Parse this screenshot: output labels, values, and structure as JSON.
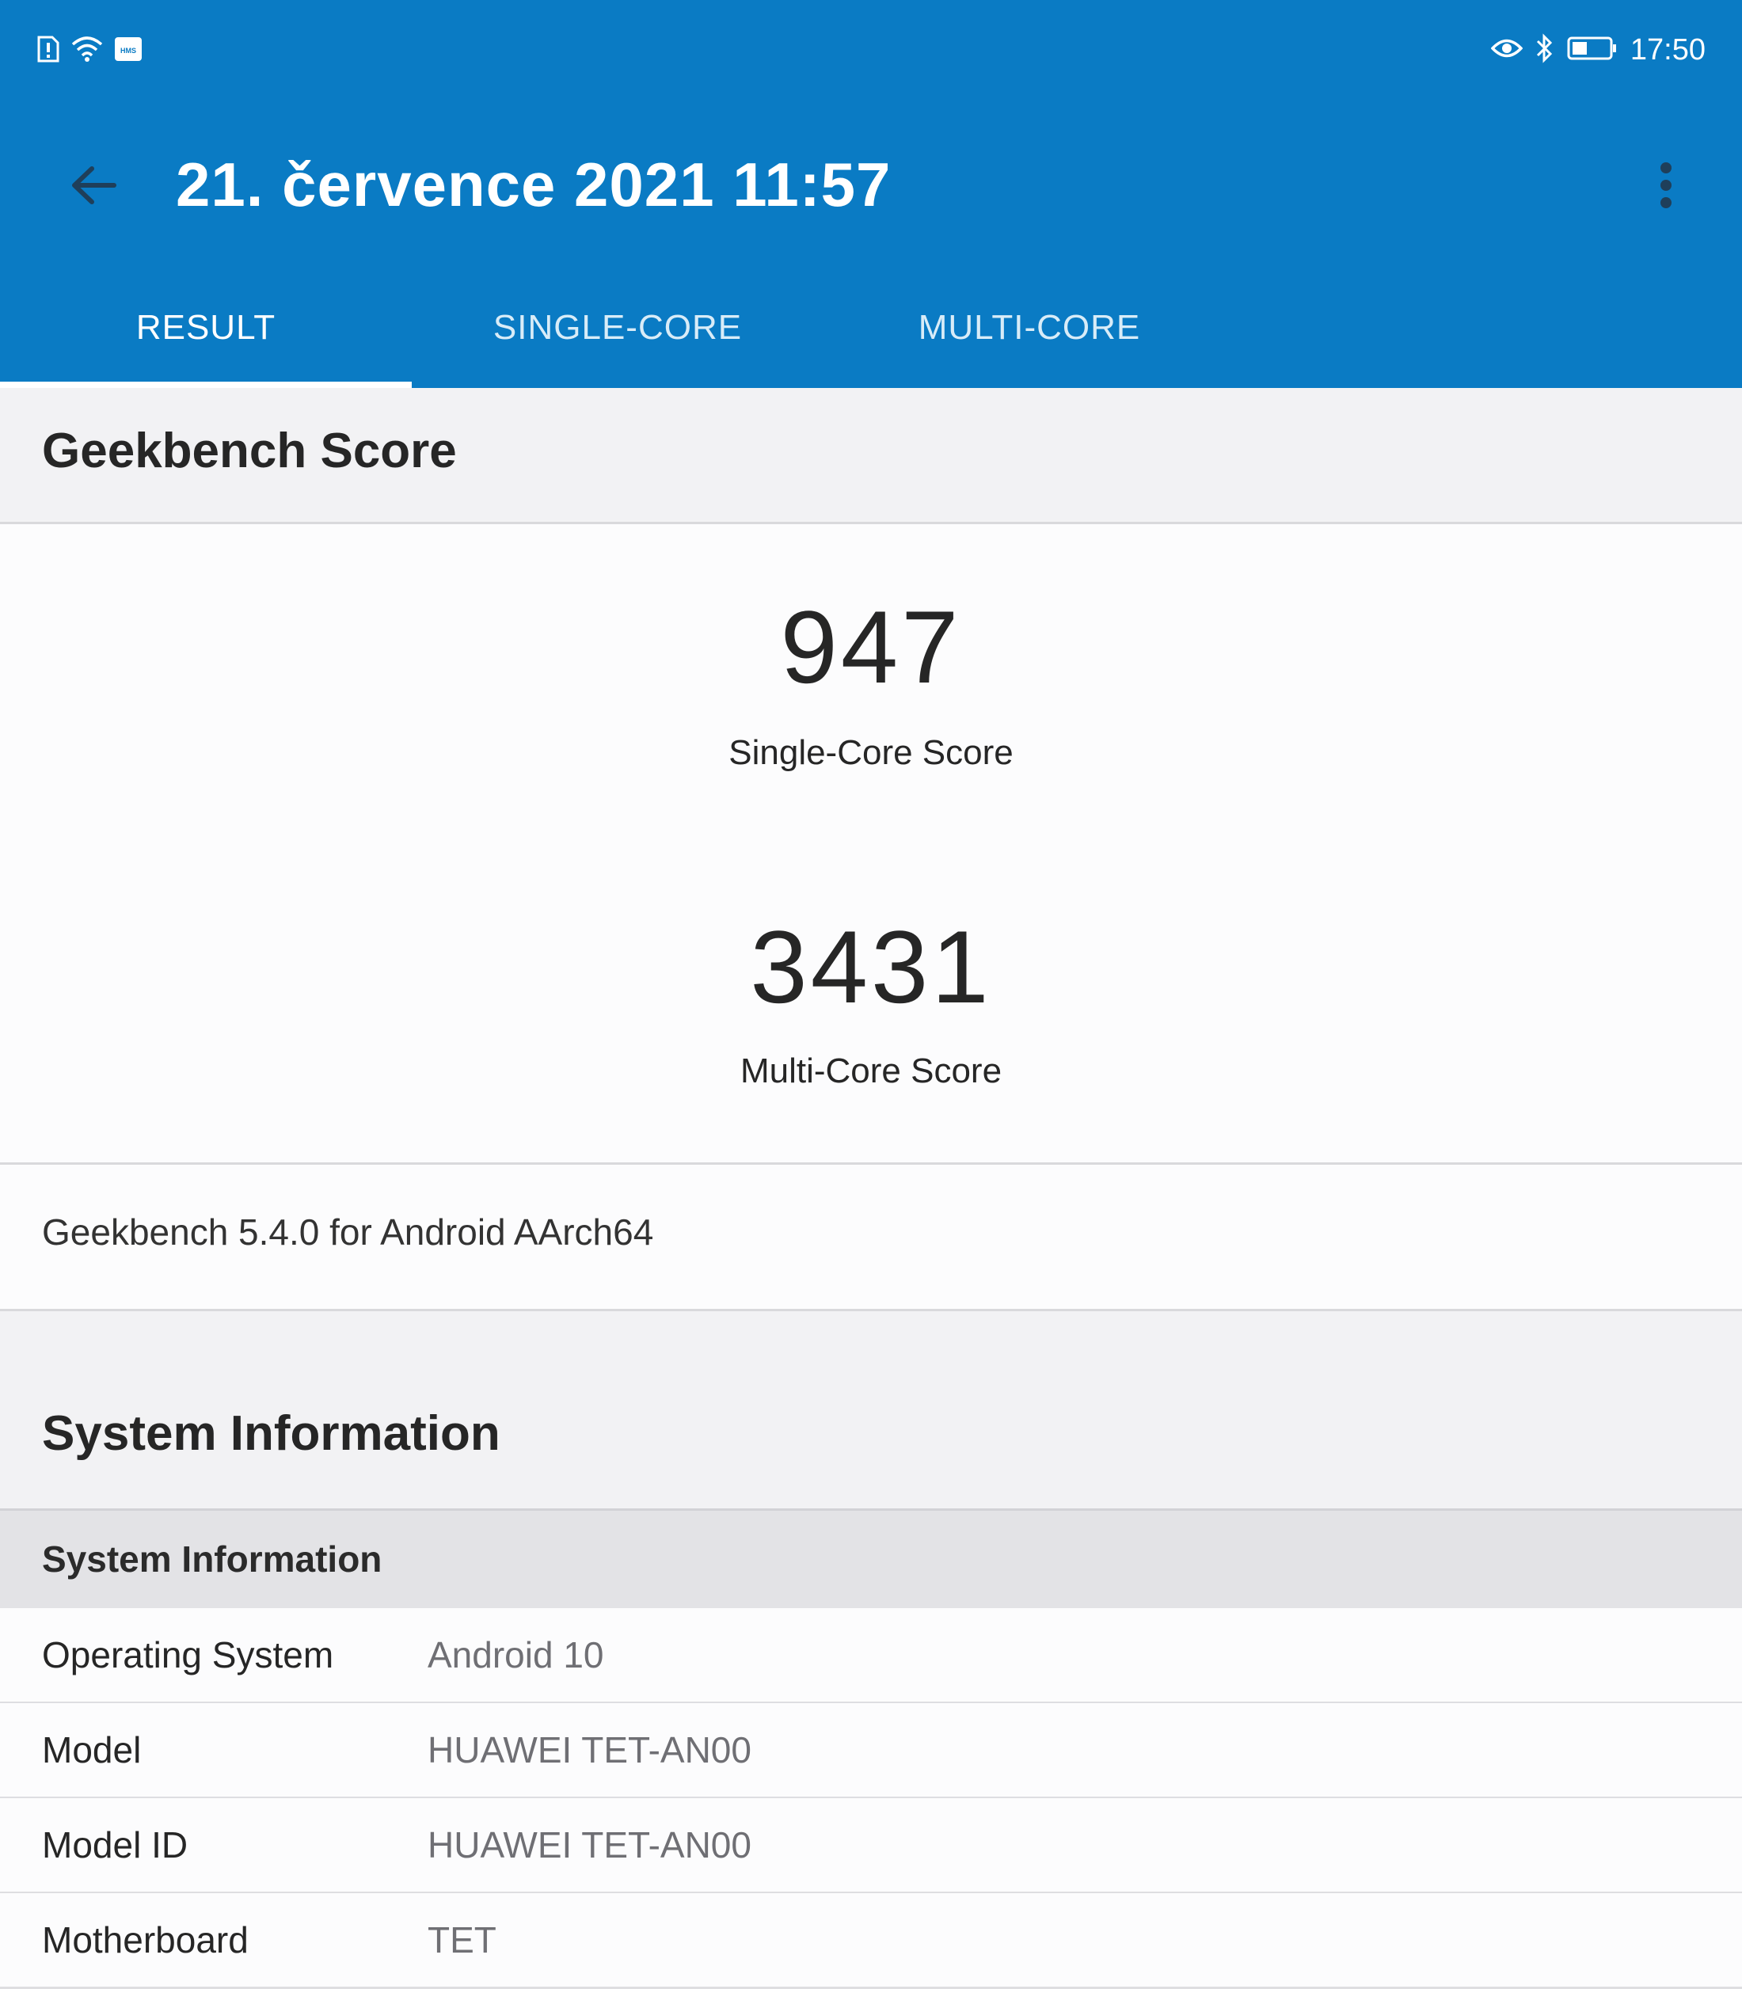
{
  "status_bar": {
    "time": "17:50",
    "left_icons": [
      "sim-alert-icon",
      "wifi-icon",
      "hms-icon"
    ],
    "right_icons": [
      "eye-icon",
      "bluetooth-icon",
      "battery-icon"
    ],
    "hms_text": "HMS"
  },
  "app_bar": {
    "title": "21. července 2021 11:57",
    "back_icon": "arrow-back-icon",
    "menu_icon": "more-vert-icon",
    "color": "#0a7bc4"
  },
  "tabs": [
    {
      "label": "RESULT",
      "active": true
    },
    {
      "label": "SINGLE-CORE",
      "active": false
    },
    {
      "label": "MULTI-CORE",
      "active": false
    }
  ],
  "score_section": {
    "title": "Geekbench Score",
    "single_core": {
      "value": "947",
      "label": "Single-Core Score"
    },
    "multi_core": {
      "value": "3431",
      "label": "Multi-Core Score"
    },
    "version": "Geekbench 5.4.0 for Android AArch64"
  },
  "system_section": {
    "title": "System Information",
    "group_label": "System Information",
    "rows": [
      {
        "key": "Operating System",
        "value": "Android 10"
      },
      {
        "key": "Model",
        "value": "HUAWEI TET-AN00"
      },
      {
        "key": "Model ID",
        "value": "HUAWEI TET-AN00"
      },
      {
        "key": "Motherboard",
        "value": "TET"
      }
    ]
  }
}
